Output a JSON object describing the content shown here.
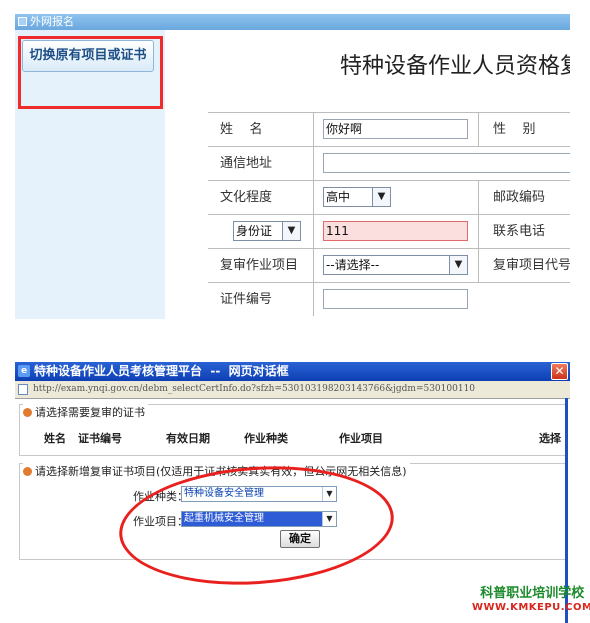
{
  "top": {
    "bar_title": "外网报名",
    "switch_button": "切换原有项目或证书",
    "page_title": "特种设备作业人员资格复",
    "form": {
      "name_label": "姓    名",
      "name_value": "你好啊",
      "gender_label": "性    别",
      "address_label": "通信地址",
      "address_value": "",
      "education_label": "文化程度",
      "education_value": "高中",
      "postcode_label": "邮政编码",
      "id_type_value": "身份证",
      "id_number_value": "111",
      "phone_label": "联系电话",
      "review_item_label": "复审作业项目",
      "review_item_value": "--请选择--",
      "review_code_label": "复审项目代号",
      "cert_no_label": "证件编号",
      "cert_no_value": ""
    }
  },
  "dialog": {
    "title": "特种设备作业人员考核管理平台  --  网页对话框",
    "close_symbol": "✕",
    "url": "http://exam.ynqi.gov.cn/debm_selectCertInfo.do?sfzh=530103198203143766&jgdm=530100110",
    "section1_legend": "请选择需要复审的证书",
    "columns": [
      "姓名",
      "证书编号",
      "有效日期",
      "作业种类",
      "作业项目",
      "选择"
    ],
    "section2_legend": "请选择新增复审证书项目(仅适用于证书核实真实有效，但公示网无相关信息)",
    "category_label": "作业种类：",
    "category_value": "特种设备安全管理",
    "project_label": "作业项目：",
    "project_value": "起重机械安全管理",
    "confirm_button": "确定"
  },
  "watermark": {
    "line1": "科普职业培训学校",
    "line2": "WWW.KMKEPU.COM"
  },
  "colors": {
    "highlight_red": "#e8201e",
    "title_blue": "#0d3fb3",
    "watermark_green": "#1b8a2b"
  }
}
